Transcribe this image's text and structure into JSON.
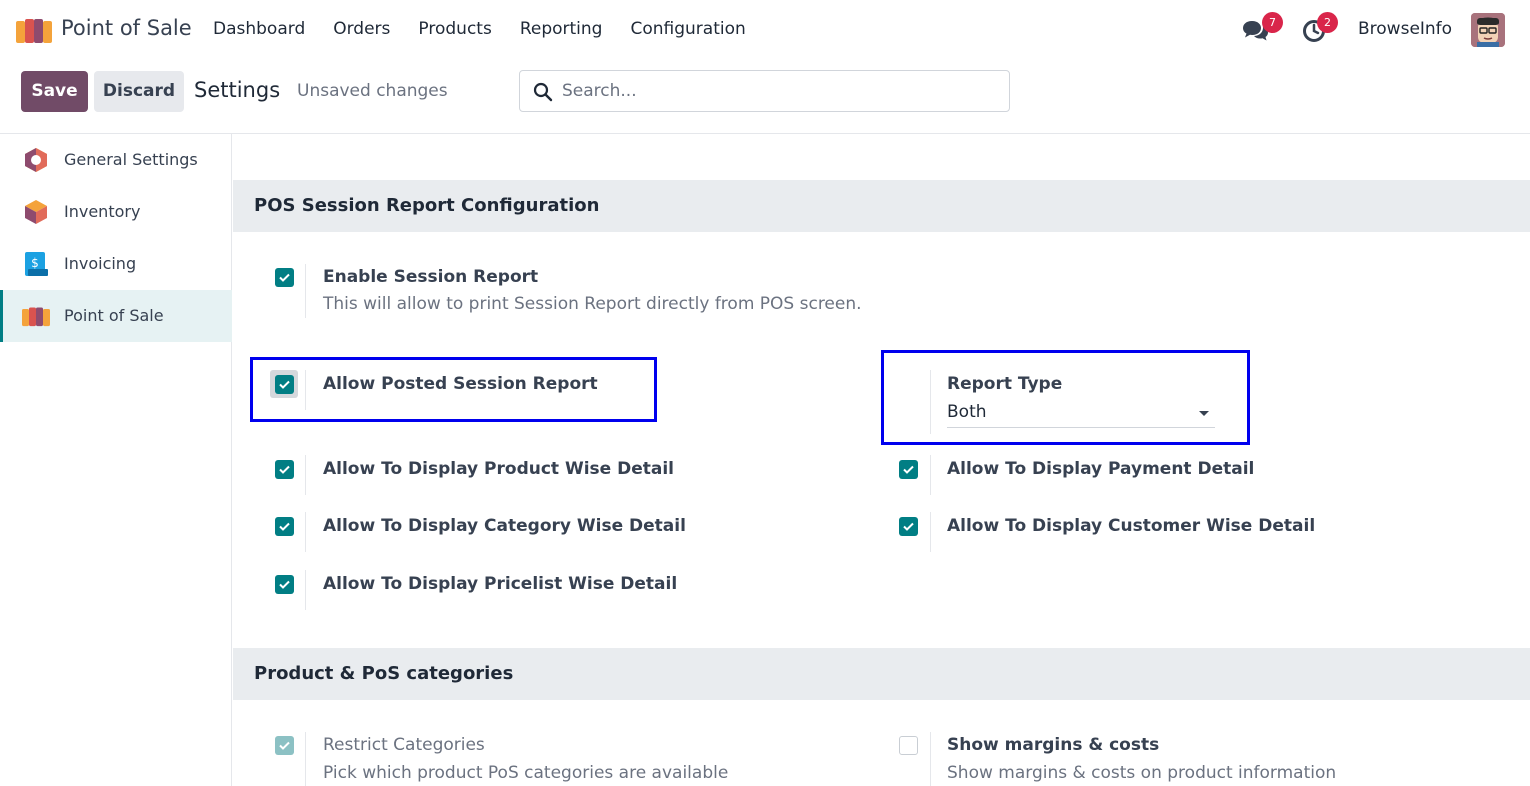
{
  "navbar": {
    "app_name": "Point of Sale",
    "menu": [
      "Dashboard",
      "Orders",
      "Products",
      "Reporting",
      "Configuration"
    ],
    "messages_badge": "7",
    "activities_badge": "2",
    "user_name": "BrowseInfo"
  },
  "control_panel": {
    "save_label": "Save",
    "discard_label": "Discard",
    "title": "Settings",
    "status": "Unsaved changes",
    "search_placeholder": "Search..."
  },
  "sidebar": {
    "items": [
      {
        "label": "General Settings",
        "icon": "general-settings-icon",
        "active": false
      },
      {
        "label": "Inventory",
        "icon": "inventory-icon",
        "active": false
      },
      {
        "label": "Invoicing",
        "icon": "invoicing-icon",
        "active": false
      },
      {
        "label": "Point of Sale",
        "icon": "point-of-sale-icon",
        "active": true
      }
    ]
  },
  "sections": {
    "pos_session_report": {
      "title": "POS Session Report Configuration",
      "enable_session_report": {
        "label": "Enable Session Report",
        "help": "This will allow to print Session Report directly from POS screen.",
        "checked": true
      },
      "allow_posted_session_report": {
        "label": "Allow Posted Session Report",
        "checked": true
      },
      "report_type": {
        "label": "Report Type",
        "value": "Both"
      },
      "product_wise": {
        "label": "Allow To Display Product Wise Detail",
        "checked": true
      },
      "payment_detail": {
        "label": "Allow To Display Payment Detail",
        "checked": true
      },
      "category_wise": {
        "label": "Allow To Display Category Wise Detail",
        "checked": true
      },
      "customer_wise": {
        "label": "Allow To Display Customer Wise Detail",
        "checked": true
      },
      "pricelist_wise": {
        "label": "Allow To Display Pricelist Wise Detail",
        "checked": true
      }
    },
    "product_categories": {
      "title": "Product & PoS categories",
      "restrict_categories": {
        "label": "Restrict Categories",
        "help": "Pick which product PoS categories are available",
        "checked": true,
        "disabled": true
      },
      "show_margins": {
        "label": "Show margins & costs",
        "help": "Show margins & costs on product information",
        "checked": false
      }
    }
  },
  "colors": {
    "brand": "#714b67",
    "checkbox": "#017e84",
    "highlight_box": "#0000ee",
    "badge": "#d9254a"
  }
}
